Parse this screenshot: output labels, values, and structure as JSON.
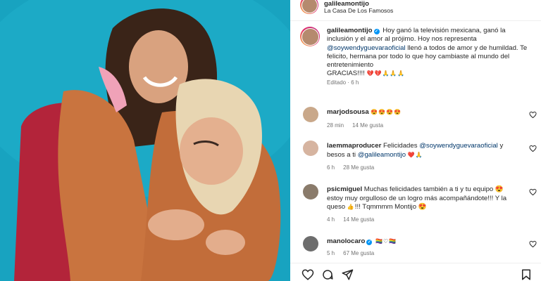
{
  "post": {
    "username": "galileamontijo",
    "location": "La Casa De Los Famosos"
  },
  "caption": {
    "username": "galileamontijo",
    "text_1": "Hoy ganó la televisión mexicana, ganó la inclusión y el amor al prójimo. Hoy nos representa ",
    "mention": "@soywendyguevaraoficial",
    "text_2": " llenó a todos de amor y de humildad. Te felicito, hermana por todo lo que hoy cambiaste al mundo del entretenimiento",
    "text_3": "GRACIAS!!!!",
    "emojis": "💔💔🙏🙏🙏",
    "edited": "Editado",
    "time": "6 h"
  },
  "comments": [
    {
      "username": "marjodsousa",
      "text": "",
      "emojis": "😍😍😍😍",
      "time": "28 min",
      "likes": "14 Me gusta",
      "verified": false,
      "avatar_color": "#c9a88a"
    },
    {
      "username": "laemmaproducer",
      "text": "Felicidades ",
      "mention": "@soywendyguevaraoficial",
      "text_b": " y besos a ti ",
      "mention_b": "@galileamontijo",
      "emojis": "❤️🙏",
      "time": "6 h",
      "likes": "28 Me gusta",
      "verified": false,
      "avatar_color": "#d6b4a0"
    },
    {
      "username": "psicmiguel",
      "text": "Muchas felicidades también a ti y tu equipo 😍 estoy muy orgulloso de un logro más acompañándote!!! Y la queso ",
      "text_b": "!!! Tqmmmm Montijo 😍",
      "emoji_mid": "👍",
      "time": "4 h",
      "likes": "14 Me gusta",
      "verified": false,
      "avatar_color": "#8a7b6b"
    },
    {
      "username": "manolocaro",
      "text": "",
      "emojis": "🏳️‍🌈♡🏳️‍🌈",
      "time": "5 h",
      "likes": "67 Me gusta",
      "verified": true,
      "avatar_color": "#6d6d6d"
    }
  ],
  "colors": {
    "accent_blue": "#0095f6",
    "mention": "#00376b",
    "muted": "#737373",
    "photo_bg": "#17a0bc"
  },
  "icons": [
    "heart-icon",
    "comment-icon",
    "share-icon",
    "bookmark-icon",
    "verified-icon"
  ]
}
